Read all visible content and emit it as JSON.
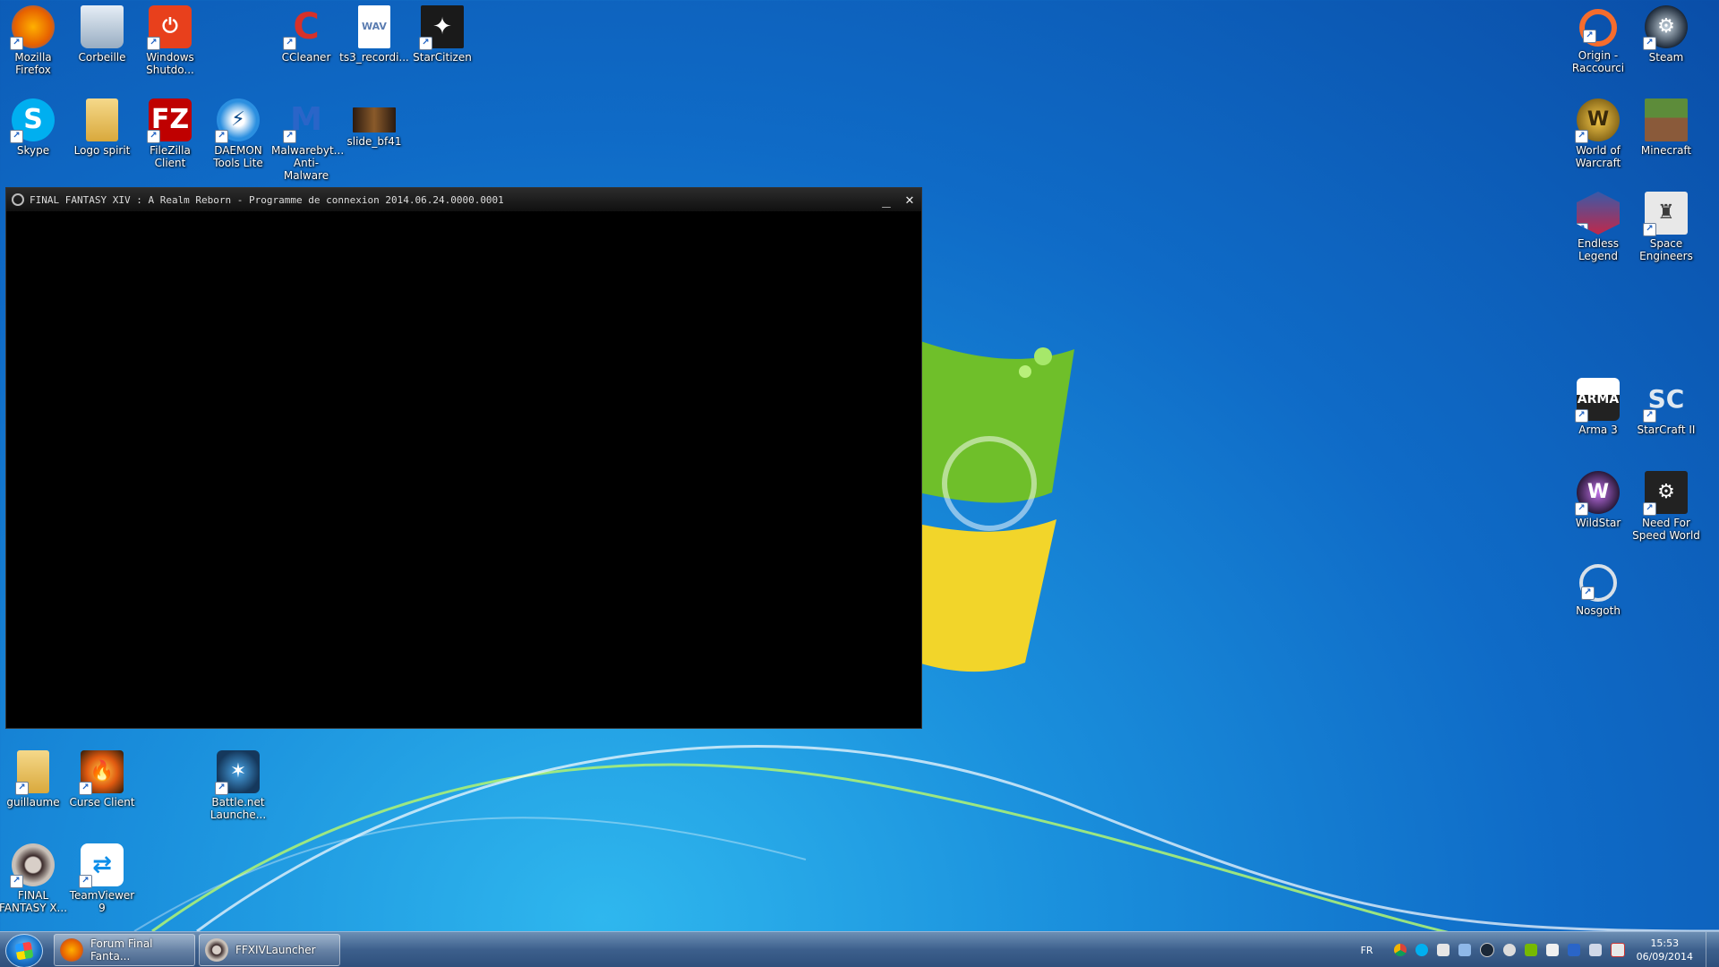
{
  "desktop": {
    "icons": [
      {
        "label": "Mozilla Firefox",
        "icon": "firefox-icon",
        "color": "#e66000"
      },
      {
        "label": "Corbeille",
        "icon": "recycle-bin-icon",
        "color": "#b7c9d9"
      },
      {
        "label": "Windows Shutdo...",
        "icon": "power-icon",
        "color": "#e8401c"
      },
      {
        "label": "CCleaner",
        "icon": "ccleaner-icon",
        "color": "#d6312a"
      },
      {
        "label": "ts3_recordi...",
        "icon": "wav-file-icon",
        "color": "#ffffff"
      },
      {
        "label": "StarCitizen",
        "icon": "starcitizen-icon",
        "color": "#1a1a1a"
      },
      {
        "label": "Skype",
        "icon": "skype-icon",
        "color": "#00aff0"
      },
      {
        "label": "Logo spirit",
        "icon": "folder-icon",
        "color": "#e9c46a"
      },
      {
        "label": "FileZilla Client",
        "icon": "filezilla-icon",
        "color": "#bf0000"
      },
      {
        "label": "DAEMON Tools Lite",
        "icon": "daemon-tools-icon",
        "color": "#2b8fe0"
      },
      {
        "label": "Malwarebyt... Anti-Malware",
        "icon": "malwarebytes-icon",
        "color": "#2a65c8"
      },
      {
        "label": "slide_bf41",
        "icon": "image-file-icon",
        "color": "#5a4a3a"
      },
      {
        "label": "guillaume",
        "icon": "user-folder-icon",
        "color": "#e9c46a"
      },
      {
        "label": "Curse Client",
        "icon": "curse-icon",
        "color": "#3a2a1a"
      },
      {
        "label": "Battle.net Launche...",
        "icon": "battlenet-icon",
        "color": "#15385c"
      },
      {
        "label": "FINAL FANTASY X...",
        "icon": "ffxiv-icon",
        "color": "#3a2a2a"
      },
      {
        "label": "TeamViewer 9",
        "icon": "teamviewer-icon",
        "color": "#0e8ee9"
      },
      {
        "label": "Origin - Raccourci",
        "icon": "origin-icon",
        "color": "#f56c2d"
      },
      {
        "label": "Steam",
        "icon": "steam-icon",
        "color": "#1b2838"
      },
      {
        "label": "World of Warcraft",
        "icon": "wow-icon",
        "color": "#8a6a1a"
      },
      {
        "label": "Minecraft",
        "icon": "minecraft-icon",
        "color": "#5d8c3a"
      },
      {
        "label": "Endless Legend",
        "icon": "endless-legend-icon",
        "color": "#c0284a"
      },
      {
        "label": "Space Engineers",
        "icon": "space-engineers-icon",
        "color": "#3a3a3a"
      },
      {
        "label": "Arma 3",
        "icon": "arma3-icon",
        "color": "#222222"
      },
      {
        "label": "StarCraft II",
        "icon": "starcraft2-icon",
        "color": "#2c4a6a"
      },
      {
        "label": "WildStar",
        "icon": "wildstar-icon",
        "color": "#6a2a8a"
      },
      {
        "label": "Need For Speed World",
        "icon": "nfs-world-icon",
        "color": "#222222"
      },
      {
        "label": "Nosgoth",
        "icon": "nosgoth-icon",
        "color": "#3a4a5a"
      }
    ]
  },
  "window": {
    "title": "FINAL FANTASY XIV : A Realm Reborn - Programme de connexion 2014.06.24.0000.0001",
    "minimize_label": "_",
    "close_label": "✕"
  },
  "taskbar": {
    "items": [
      {
        "label": "Forum Final Fanta...",
        "icon": "firefox-icon",
        "color": "#e66000"
      },
      {
        "label": "FFXIVLauncher",
        "icon": "ffxiv-icon",
        "color": "#3a2a2a"
      }
    ],
    "tray": {
      "language": "FR",
      "time": "15:53",
      "date": "06/09/2014"
    }
  }
}
